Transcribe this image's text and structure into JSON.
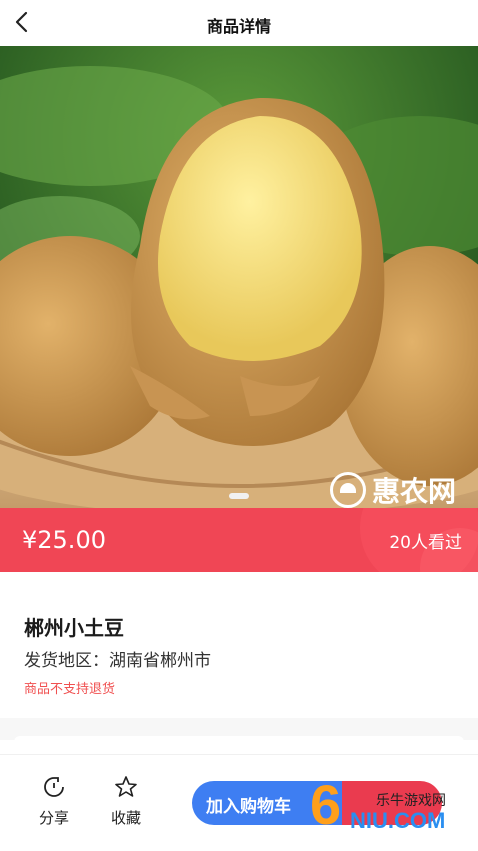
{
  "header": {
    "title": "商品详情"
  },
  "hero": {
    "watermark": "惠农网"
  },
  "price": {
    "value": "¥25.00",
    "views": "20人看过"
  },
  "product": {
    "name": "郴州小土豆",
    "origin": "发货地区：湖南省郴州市",
    "notice": "商品不支持退货"
  },
  "bottom": {
    "share_label": "分享",
    "favorite_label": "收藏",
    "cart_label": "加入购物车"
  },
  "overlay": {
    "site_number": "6",
    "site_name": "乐牛游戏网",
    "site_domain": "NIU.COM"
  },
  "colors": {
    "price_bar": "#f04655",
    "cart_button": "#3e7ef2",
    "buy_button": "#ea3b4f",
    "notice": "#f05050"
  }
}
